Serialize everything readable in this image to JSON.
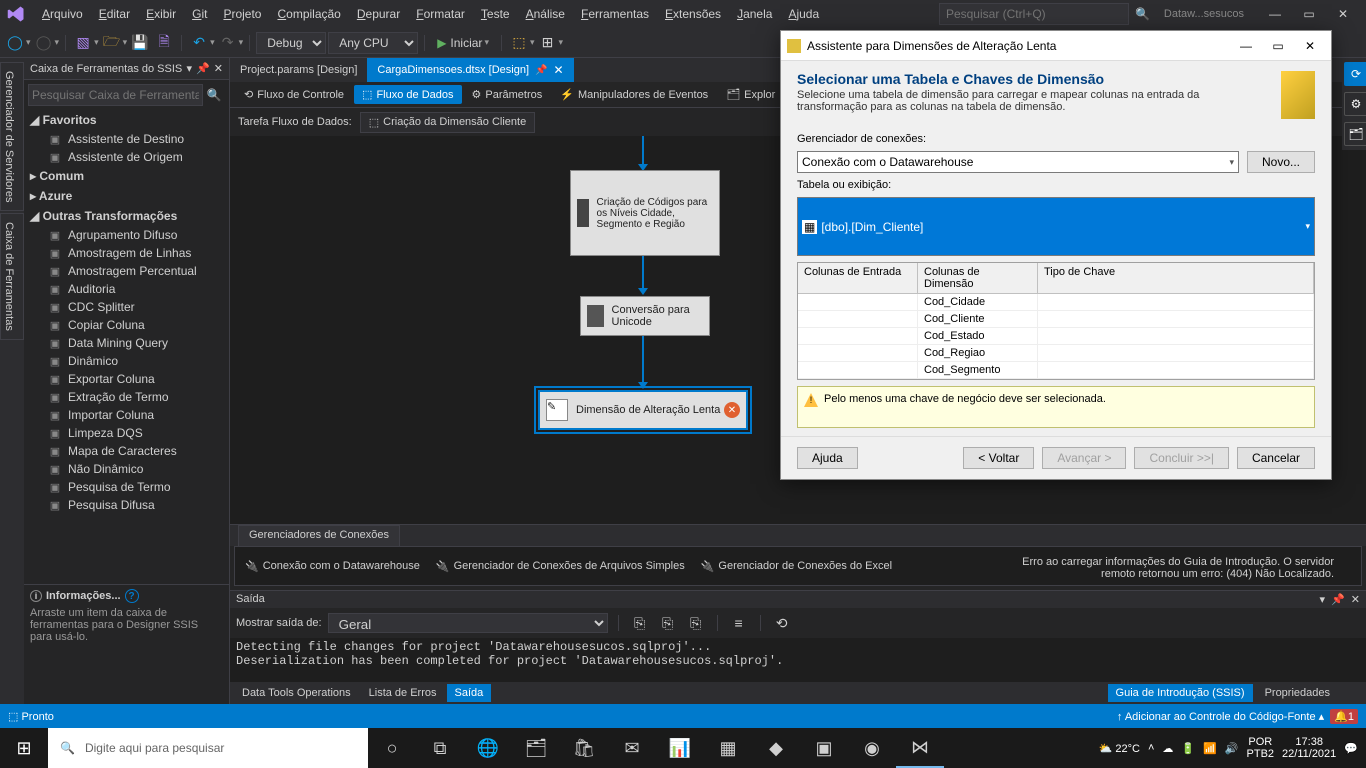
{
  "menu": [
    "Arquivo",
    "Editar",
    "Exibir",
    "Git",
    "Projeto",
    "Compilação",
    "Depurar",
    "Formatar",
    "Teste",
    "Análise",
    "Ferramentas",
    "Extensões",
    "Janela",
    "Ajuda"
  ],
  "title_search_placeholder": "Pesquisar (Ctrl+Q)",
  "solution_name": "Dataw...sesucos",
  "toolbar": {
    "config": "Debug",
    "platform": "Any CPU",
    "start": "Iniciar"
  },
  "side_tabs": [
    "Gerenciador de Servidores",
    "Caixa de Ferramentas"
  ],
  "toolbox": {
    "title": "Caixa de Ferramentas do SSIS",
    "search": "Pesquisar Caixa de Ferramentas",
    "groups": [
      {
        "name": "Favoritos",
        "open": true,
        "items": [
          "Assistente de Destino",
          "Assistente de Origem"
        ]
      },
      {
        "name": "Comum",
        "open": false,
        "items": []
      },
      {
        "name": "Azure",
        "open": false,
        "items": []
      },
      {
        "name": "Outras Transformações",
        "open": true,
        "items": [
          "Agrupamento Difuso",
          "Amostragem de Linhas",
          "Amostragem Percentual",
          "Auditoria",
          "CDC Splitter",
          "Copiar Coluna",
          "Data Mining Query",
          "Dinâmico",
          "Exportar Coluna",
          "Extração de Termo",
          "Importar Coluna",
          "Limpeza DQS",
          "Mapa de Caracteres",
          "Não Dinâmico",
          "Pesquisa de Termo",
          "Pesquisa Difusa"
        ]
      }
    ],
    "info_title": "Informações...",
    "info_body": "Arraste um item da caixa de ferramentas para o Designer SSIS para usá-lo."
  },
  "doc_tabs": [
    {
      "label": "Project.params [Design]",
      "active": false
    },
    {
      "label": "CargaDimensoes.dtsx [Design]",
      "active": true
    }
  ],
  "design_tabs": [
    "Fluxo de Controle",
    "Fluxo de Dados",
    "Parâmetros",
    "Manipuladores de Eventos",
    "Explor"
  ],
  "design_active": 1,
  "task_label": "Tarefa Fluxo de Dados:",
  "task_value": "Criação da Dimensão Cliente",
  "nodes": {
    "n1": "Criação de Códigos para os Níveis Cidade, Segmento e Região",
    "n2": "Conversão para Unicode",
    "n3": "Dimensão de Alteração Lenta"
  },
  "conn_tab": "Gerenciadores de Conexões",
  "connections": [
    "Conexão com o Datawarehouse",
    "Gerenciador de Conexões de Arquivos Simples",
    "Gerenciador de Conexões do Excel"
  ],
  "output": {
    "title": "Saída",
    "show_label": "Mostrar saída de:",
    "show_value": "Geral",
    "text": "Detecting file changes for project 'Datawarehousesucos.sqlproj'...\nDeserialization has been completed for project 'Datawarehousesucos.sqlproj'."
  },
  "bottom_tabs": [
    "Data Tools Operations",
    "Lista de Erros",
    "Saída"
  ],
  "bottom_active": 2,
  "right_error": "Erro ao carregar informações do Guia de Introdução. O servidor remoto retornou um erro: (404) Não Localizado.",
  "right_tabs": [
    "Guia de Introdução (SSIS)",
    "Propriedades"
  ],
  "statusbar": {
    "ready": "Pronto",
    "source_control": "Adicionar ao Controle do Código-Fonte"
  },
  "taskbar_search": "Digite aqui para pesquisar",
  "tray": {
    "weather": "22°C",
    "lang1": "POR",
    "lang2": "PTB2",
    "time": "17:38",
    "date": "22/11/2021"
  },
  "dialog": {
    "title": "Assistente para Dimensões de Alteração Lenta",
    "head_title": "Selecionar uma Tabela e Chaves de Dimensão",
    "head_sub": "Selecione uma tabela de dimensão para carregar e mapear colunas na entrada da transformação para as colunas na tabela de dimensão.",
    "conn_label": "Gerenciador de conexões:",
    "conn_value": "Conexão com o Datawarehouse",
    "new_btn": "Novo...",
    "table_label": "Tabela ou exibição:",
    "table_value": "[dbo].[Dim_Cliente]",
    "grid_headers": [
      "Colunas de Entrada",
      "Colunas de Dimensão",
      "Tipo de Chave"
    ],
    "grid_rows": [
      {
        "in": "",
        "dim": "Cod_Cidade",
        "key": ""
      },
      {
        "in": "",
        "dim": "Cod_Cliente",
        "key": ""
      },
      {
        "in": "",
        "dim": "Cod_Estado",
        "key": ""
      },
      {
        "in": "",
        "dim": "Cod_Regiao",
        "key": ""
      },
      {
        "in": "",
        "dim": "Cod_Segmento",
        "key": ""
      }
    ],
    "warning": "Pelo menos uma chave de negócio deve ser selecionada.",
    "btn_help": "Ajuda",
    "btn_back": "< Voltar",
    "btn_next": "Avançar >",
    "btn_finish": "Concluir >>|",
    "btn_cancel": "Cancelar"
  }
}
